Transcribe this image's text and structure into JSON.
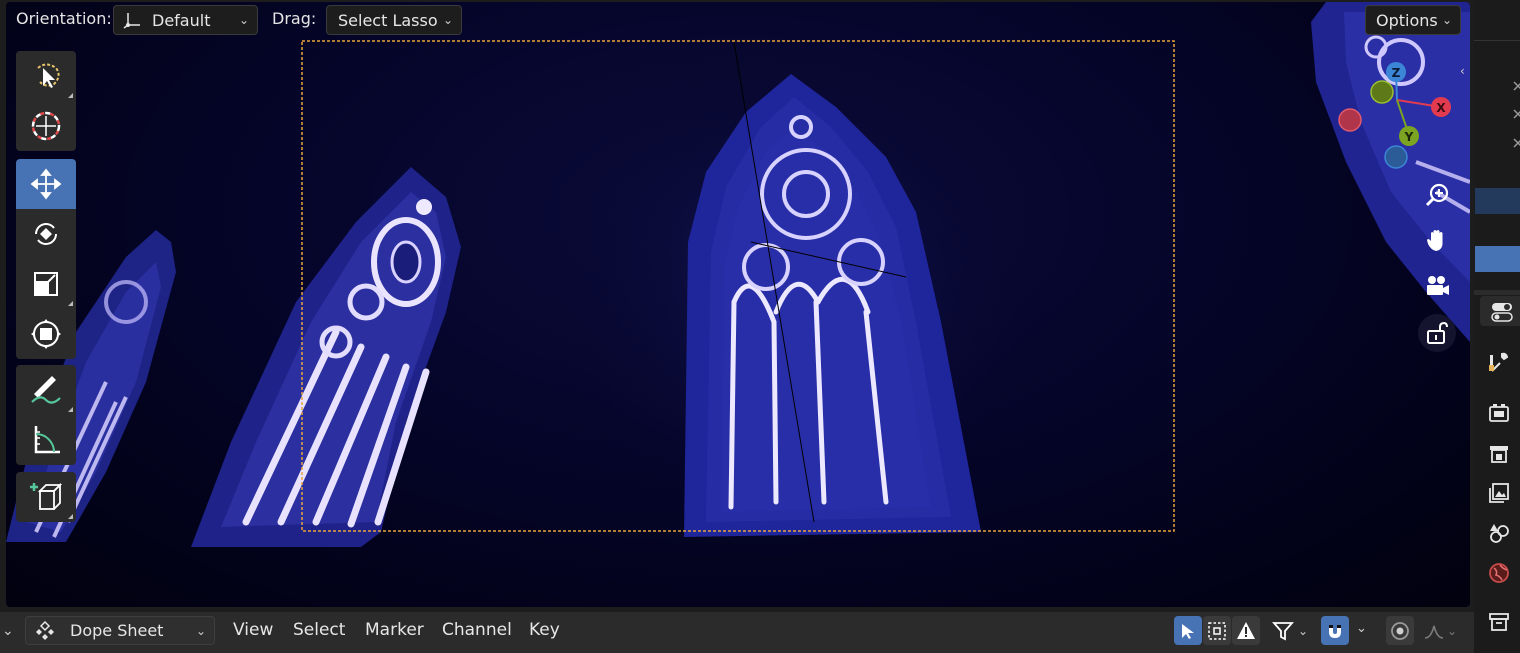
{
  "header": {
    "orientation_label": "Orientation:",
    "orientation_value": "Default",
    "drag_label": "Drag:",
    "drag_value": "Select Lasso",
    "options_label": "Options"
  },
  "toolbar": {
    "tools": [
      "select-lasso",
      "cursor",
      "move",
      "rotate",
      "scale",
      "transform",
      "annotate",
      "measure",
      "add-cube"
    ],
    "active_tool": "move"
  },
  "gizmo": {
    "x": "X",
    "y": "Y",
    "z": "Z"
  },
  "bottom_bar": {
    "editor_type": "Dope Sheet",
    "menus": [
      "View",
      "Select",
      "Marker",
      "Channel",
      "Key"
    ]
  },
  "colors": {
    "accent": "#4772b3",
    "camera_frame": "#e8a33a",
    "axis_x": "#e23b50",
    "axis_y": "#7ca321",
    "axis_z": "#3b86d6"
  }
}
